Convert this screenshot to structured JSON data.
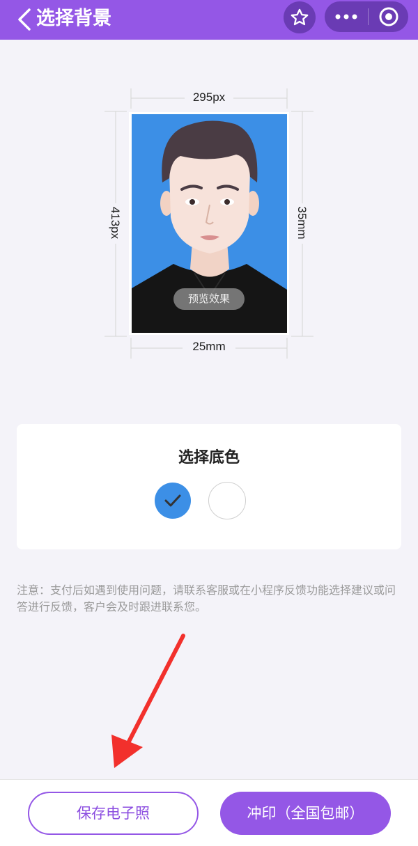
{
  "header": {
    "title": "选择背景",
    "back_icon": "chevron-left-icon",
    "favorite_icon": "star-icon",
    "more_icon": "more-dots-icon",
    "close_icon": "target-circle-icon",
    "background_color": "#9457e6"
  },
  "photo": {
    "width_label": "295px",
    "height_label": "413px",
    "physical_width_label": "25mm",
    "physical_height_label": "35mm",
    "preview_badge": "预览效果",
    "background_color": "#3c8fe6"
  },
  "color_picker": {
    "title": "选择底色",
    "options": [
      {
        "color": "#3c8fe6",
        "selected": true
      },
      {
        "color": "#ffffff",
        "selected": false
      }
    ],
    "check_icon": "check-icon"
  },
  "notice": {
    "text": "注意：支付后如遇到使用问题，请联系客服或在小程序反馈功能选择建议或问答进行反馈，客户会及时跟进联系您。"
  },
  "actions": {
    "save_label": "保存电子照",
    "print_label": "冲印（全国包邮）",
    "accent_color": "#9457e6"
  },
  "annotation": {
    "arrow_icon": "red-arrow-icon",
    "arrow_color": "#f2302c"
  }
}
